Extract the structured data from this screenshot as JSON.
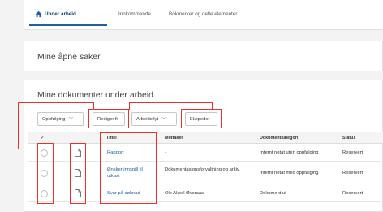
{
  "tabs": [
    {
      "label": "Under arbeid",
      "active": true,
      "icon": "home-icon"
    },
    {
      "label": "Innkommende",
      "active": false
    },
    {
      "label": "Bokmerker og delte elementer",
      "active": false
    }
  ],
  "cards": {
    "open_cases_title": "Mine åpne saker",
    "documents_title": "Mine dokumenter under arbeid"
  },
  "toolbar": {
    "followup": "Oppfølging",
    "edit_file": "Rediger fil",
    "workflow": "Arbeidsflyt",
    "dispatch": "Ekspeder"
  },
  "table": {
    "check_header": "✓",
    "headers": [
      "Tittel",
      "Mottaker",
      "Dokumentkategori",
      "Status"
    ],
    "rows": [
      {
        "title": "Rapport",
        "recipient": "-",
        "category": "Internt notat uten oppfølging",
        "status": "Reservert"
      },
      {
        "title": "Ønsker innspill til utkast",
        "recipient": "Dokumentasjonsforvaltning og arkiv",
        "category": "Internt notat med oppfølging",
        "status": "Reservert"
      },
      {
        "title": "Svar på søknad",
        "recipient": "Ole Aksel Øveraas",
        "category": "Dokument ut",
        "status": "Reservert"
      }
    ]
  },
  "colors": {
    "accent": "#1f5fa3",
    "highlight": "#e5322d"
  }
}
